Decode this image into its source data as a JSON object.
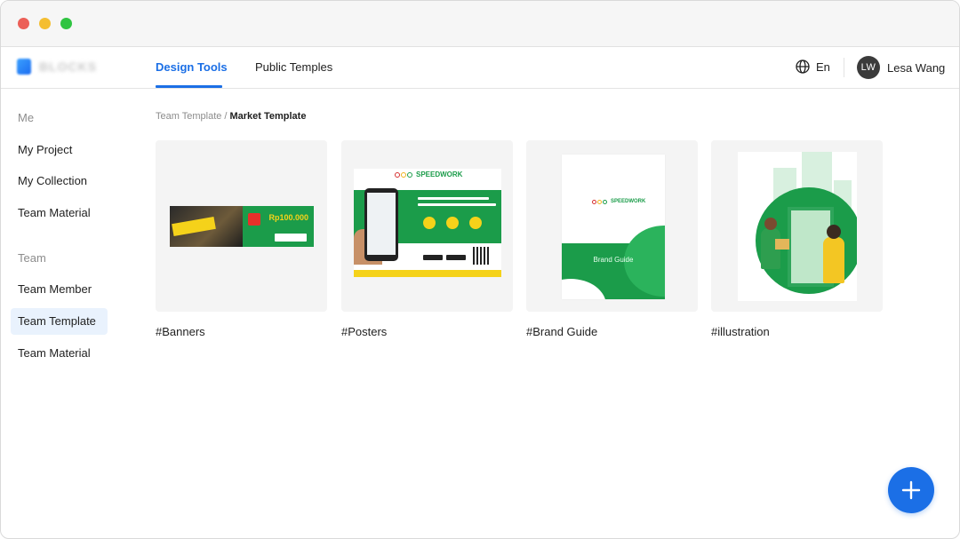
{
  "nav": {
    "tabs": [
      {
        "label": "Design Tools",
        "active": true
      },
      {
        "label": "Public Temples",
        "active": false
      }
    ],
    "language": "En",
    "user": {
      "initials": "LW",
      "name": "Lesa Wang"
    }
  },
  "sidebar": {
    "sections": [
      {
        "title": "Me",
        "items": [
          {
            "label": "My Project"
          },
          {
            "label": "My Collection"
          },
          {
            "label": "Team Material"
          }
        ]
      },
      {
        "title": "Team",
        "items": [
          {
            "label": "Team Member"
          },
          {
            "label": "Team Template",
            "active": true
          },
          {
            "label": "Team Material"
          }
        ]
      }
    ]
  },
  "breadcrumb": {
    "parent": "Team Template",
    "separator": "/",
    "current": "Market Template"
  },
  "cards": [
    {
      "label": "#Banners",
      "thumb_price": "Rp100.000"
    },
    {
      "label": "#Posters",
      "thumb_brand": "SPEEDWORK"
    },
    {
      "label": "#Brand Guide",
      "thumb_brand": "SPEEDWORK",
      "thumb_title": "Brand Guide"
    },
    {
      "label": "#illustration"
    }
  ],
  "colors": {
    "accent": "#1b6fe6",
    "brand_green": "#1b9c4a",
    "active_bg": "#e9f2fd"
  },
  "icons": {
    "language": "globe-icon",
    "fab": "plus-icon"
  }
}
